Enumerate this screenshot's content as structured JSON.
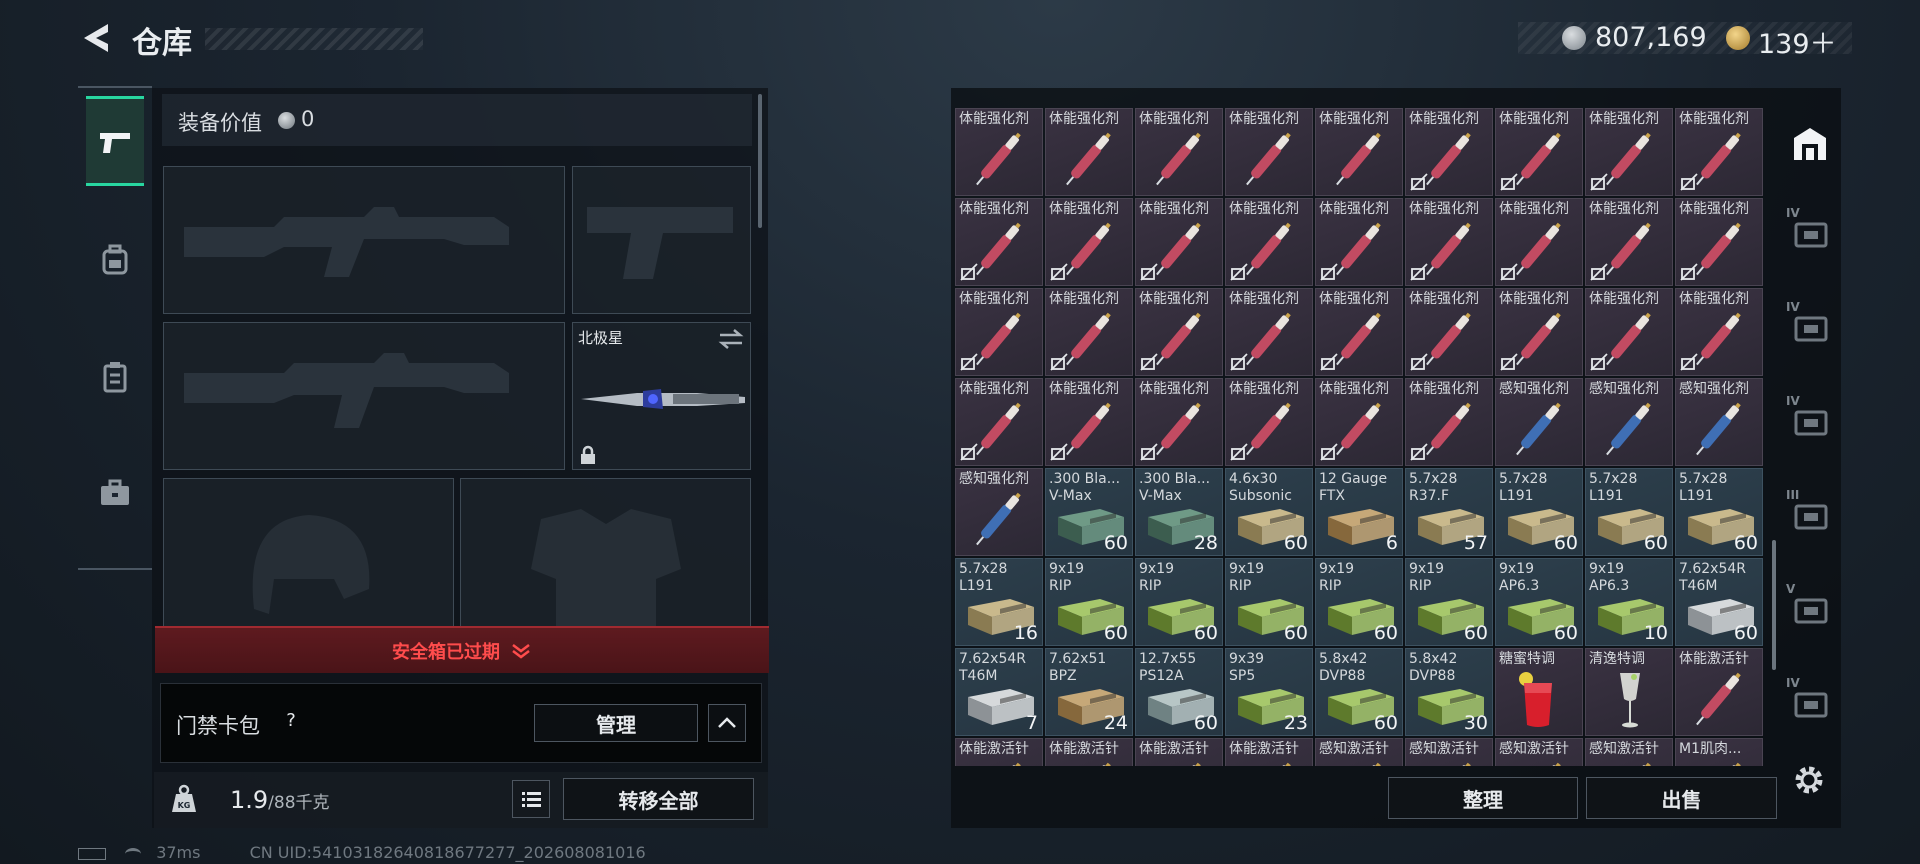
{
  "header": {
    "title": "仓库",
    "currency_primary": "807,169",
    "currency_secondary": "139＋"
  },
  "equipment": {
    "value_label": "装备价值",
    "value": "0",
    "melee_name": "北极星",
    "secure_case_status": "安全箱已过期"
  },
  "keycard": {
    "label": "门禁卡包",
    "help": "?",
    "manage_label": "管理"
  },
  "weight": {
    "current": "1.9",
    "max": "/88千克",
    "transfer_all_label": "转移全部"
  },
  "inventory": {
    "sort_label": "整理",
    "sell_label": "出售",
    "rows": [
      [
        {
          "name": "体能强化剂",
          "type": "med",
          "locked": false
        },
        {
          "name": "体能强化剂",
          "type": "med",
          "locked": false
        },
        {
          "name": "体能强化剂",
          "type": "med",
          "locked": false
        },
        {
          "name": "体能强化剂",
          "type": "med",
          "locked": false
        },
        {
          "name": "体能强化剂",
          "type": "med",
          "locked": false
        },
        {
          "name": "体能强化剂",
          "type": "med",
          "locked": true
        },
        {
          "name": "体能强化剂",
          "type": "med",
          "locked": true
        },
        {
          "name": "体能强化剂",
          "type": "med",
          "locked": true
        },
        {
          "name": "体能强化剂",
          "type": "med",
          "locked": true
        }
      ],
      [
        {
          "name": "体能强化剂",
          "type": "med",
          "locked": true
        },
        {
          "name": "体能强化剂",
          "type": "med",
          "locked": true
        },
        {
          "name": "体能强化剂",
          "type": "med",
          "locked": true
        },
        {
          "name": "体能强化剂",
          "type": "med",
          "locked": true
        },
        {
          "name": "体能强化剂",
          "type": "med",
          "locked": true
        },
        {
          "name": "体能强化剂",
          "type": "med",
          "locked": true
        },
        {
          "name": "体能强化剂",
          "type": "med",
          "locked": true
        },
        {
          "name": "体能强化剂",
          "type": "med",
          "locked": true
        },
        {
          "name": "体能强化剂",
          "type": "med",
          "locked": true
        }
      ],
      [
        {
          "name": "体能强化剂",
          "type": "med",
          "locked": true
        },
        {
          "name": "体能强化剂",
          "type": "med",
          "locked": true
        },
        {
          "name": "体能强化剂",
          "type": "med",
          "locked": true
        },
        {
          "name": "体能强化剂",
          "type": "med",
          "locked": true
        },
        {
          "name": "体能强化剂",
          "type": "med",
          "locked": true
        },
        {
          "name": "体能强化剂",
          "type": "med",
          "locked": true
        },
        {
          "name": "体能强化剂",
          "type": "med",
          "locked": true
        },
        {
          "name": "体能强化剂",
          "type": "med",
          "locked": true
        },
        {
          "name": "体能强化剂",
          "type": "med",
          "locked": true
        }
      ],
      [
        {
          "name": "体能强化剂",
          "type": "med",
          "locked": true
        },
        {
          "name": "体能强化剂",
          "type": "med",
          "locked": true
        },
        {
          "name": "体能强化剂",
          "type": "med",
          "locked": true
        },
        {
          "name": "体能强化剂",
          "type": "med",
          "locked": true
        },
        {
          "name": "体能强化剂",
          "type": "med",
          "locked": true
        },
        {
          "name": "体能强化剂",
          "type": "med",
          "locked": true
        },
        {
          "name": "感知强化剂",
          "type": "medb",
          "locked": false
        },
        {
          "name": "感知强化剂",
          "type": "medb",
          "locked": false
        },
        {
          "name": "感知强化剂",
          "type": "medb",
          "locked": false
        }
      ],
      [
        {
          "name": "感知强化剂",
          "type": "medb",
          "locked": false
        },
        {
          "name": ".300 Bla...",
          "sub": "V-Max",
          "type": "ammo",
          "box": "teal",
          "count": "60"
        },
        {
          "name": ".300 Bla...",
          "sub": "V-Max",
          "type": "ammo",
          "box": "teal",
          "count": "28"
        },
        {
          "name": "4.6x30",
          "sub": "Subsonic",
          "type": "ammo",
          "box": "tan",
          "count": "60"
        },
        {
          "name": "12 Gauge",
          "sub": "FTX",
          "type": "ammo",
          "box": "tanbig",
          "count": "6"
        },
        {
          "name": "5.7x28",
          "sub": "R37.F",
          "type": "ammo",
          "box": "tan",
          "count": "57"
        },
        {
          "name": "5.7x28",
          "sub": "L191",
          "type": "ammo",
          "box": "tan",
          "count": "60"
        },
        {
          "name": "5.7x28",
          "sub": "L191",
          "type": "ammo",
          "box": "tan",
          "count": "60"
        },
        {
          "name": "5.7x28",
          "sub": "L191",
          "type": "ammo",
          "box": "tan",
          "count": "60"
        }
      ],
      [
        {
          "name": "5.7x28",
          "sub": "L191",
          "type": "ammo",
          "box": "tan",
          "count": "16"
        },
        {
          "name": "9x19",
          "sub": "RIP",
          "type": "ammo",
          "box": "green",
          "count": "60"
        },
        {
          "name": "9x19",
          "sub": "RIP",
          "type": "ammo",
          "box": "green",
          "count": "60"
        },
        {
          "name": "9x19",
          "sub": "RIP",
          "type": "ammo",
          "box": "green",
          "count": "60"
        },
        {
          "name": "9x19",
          "sub": "RIP",
          "type": "ammo",
          "box": "green",
          "count": "60"
        },
        {
          "name": "9x19",
          "sub": "RIP",
          "type": "ammo",
          "box": "green",
          "count": "60"
        },
        {
          "name": "9x19",
          "sub": "AP6.3",
          "type": "ammo",
          "box": "green",
          "count": "60"
        },
        {
          "name": "9x19",
          "sub": "AP6.3",
          "type": "ammo",
          "box": "green",
          "count": "10"
        },
        {
          "name": "7.62x54R",
          "sub": "T46M",
          "type": "ammo",
          "box": "white",
          "count": "60"
        }
      ],
      [
        {
          "name": "7.62x54R",
          "sub": "T46M",
          "type": "ammo",
          "box": "white",
          "count": "7"
        },
        {
          "name": "7.62x51",
          "sub": "BPZ",
          "type": "ammo",
          "box": "tanbig",
          "count": "24"
        },
        {
          "name": "12.7x55",
          "sub": "PS12A",
          "type": "ammo",
          "box": "pale",
          "count": "60"
        },
        {
          "name": "9x39",
          "sub": "SP5",
          "type": "ammo",
          "box": "green",
          "count": "23"
        },
        {
          "name": "5.8x42",
          "sub": "DVP88",
          "type": "ammo",
          "box": "green",
          "count": "60"
        },
        {
          "name": "5.8x42",
          "sub": "DVP88",
          "type": "ammo",
          "box": "green",
          "count": "30"
        },
        {
          "name": "糖蜜特调",
          "type": "drink",
          "kind": "red"
        },
        {
          "name": "清逸特调",
          "type": "drink",
          "kind": "clear"
        },
        {
          "name": "体能激活针",
          "type": "med",
          "locked": false
        }
      ],
      [
        {
          "name": "体能激活针",
          "type": "med",
          "locked": false
        },
        {
          "name": "体能激活针",
          "type": "med",
          "locked": false
        },
        {
          "name": "体能激活针",
          "type": "med",
          "locked": false
        },
        {
          "name": "体能激活针",
          "type": "med",
          "locked": false
        },
        {
          "name": "感知激活针",
          "type": "medb",
          "locked": false
        },
        {
          "name": "感知激活针",
          "type": "medb",
          "locked": false
        },
        {
          "name": "感知激活针",
          "type": "medb",
          "locked": false
        },
        {
          "name": "感知激活针",
          "type": "medb",
          "locked": false
        },
        {
          "name": "M1肌肉...",
          "type": "med",
          "locked": false
        }
      ]
    ]
  },
  "right_nav": {
    "tiers": [
      "IV",
      "IV",
      "IV",
      "III",
      "V",
      "IV"
    ]
  },
  "status_bar": {
    "ping": "37ms",
    "uid": "CN UID:54103182640818677277_202608081016"
  },
  "colors": {
    "accent": "#28d6a0",
    "alert": "#ff4c4c",
    "med_cell": "#2c2834",
    "ammo_cell": "#263642"
  }
}
